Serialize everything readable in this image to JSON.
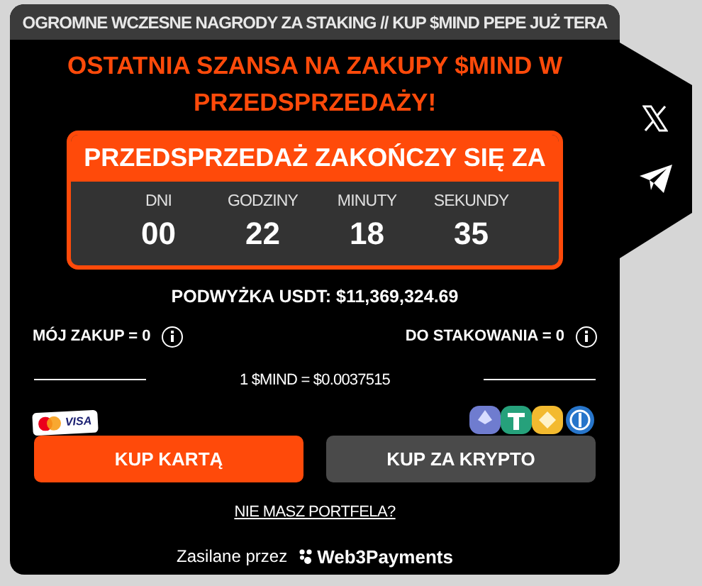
{
  "ticker": "OGROMNE WCZESNE NAGRODY ZA STAKING // KUP $MIND PEPE JUŻ TERA",
  "headline": "OSTATNIA SZANSA NA ZAKUPY $MIND W PRZEDSPRZEDAŻY!",
  "countdown": {
    "title": "PRZEDSPRZEDAŻ ZAKOŃCZY SIĘ ZA",
    "units": [
      {
        "label": "DNI",
        "value": "00"
      },
      {
        "label": "GODZINY",
        "value": "22"
      },
      {
        "label": "MINUTY",
        "value": "18"
      },
      {
        "label": "SEKUNDY",
        "value": "35"
      }
    ]
  },
  "raised": "PODWYŻKA USDT: $11,369,324.69",
  "my_purchase": "MÓJ ZAKUP = 0",
  "to_stake": "DO STAKOWANIA = 0",
  "rate": "1 $MIND = $0.0037515",
  "card_logo_text": "VISA",
  "buttons": [
    {
      "label": "KUP KARTĄ",
      "kind": "primary"
    },
    {
      "label": "KUP ZA KRYPTO",
      "kind": "secondary"
    }
  ],
  "no_wallet_link": "NIE MASZ PORTFELA?",
  "powered_by": "Zasilane przez",
  "provider": "Web3Payments"
}
